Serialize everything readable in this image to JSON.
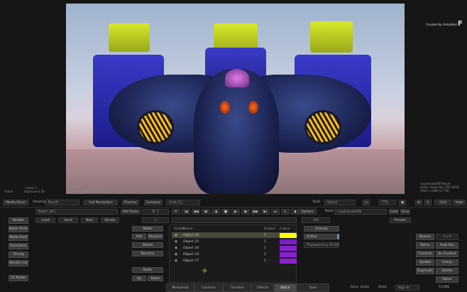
{
  "viewer": {
    "brand_text": "Created by Autodesk",
    "brand_logo": "F",
    "info_right": [
      "cryptomattefB Result",
      "Active linear Rec 709 sRGB",
      "1920 x 1080 (1.778)"
    ],
    "info_left_status": "Active",
    "info_left_a": "Linear 1",
    "info_left_b": "Exposure 0.00",
    "info_left_c": "Contrast 1.00",
    "info_left_d": "Gamma 2.20",
    "info_left_e": "Look off"
  },
  "toolbar": {
    "media_panel": "Media Panel",
    "viewing_label": "Viewing",
    "viewing_value": "Result",
    "full_resolution": "Full Resolution",
    "preview": "Preview",
    "compare": "Compare",
    "grab": "Grab [1]",
    "tools_label": "Tools",
    "tools_value": "Select",
    "ratio_value": "TTR",
    "grid": "Grid",
    "view": "View"
  },
  "left_panel": {
    "render": "Render",
    "batch_prefs": "Batch Prefs",
    "node_prefs": "Node Prefs",
    "animation": "Animation",
    "timing": "Timing",
    "render_list": "Render List",
    "fx_nodes": "FX Nodes",
    "batch_name": "Batch_001",
    "add_token": "Add Token",
    "load": "Load",
    "save": "Save",
    "new": "New",
    "iterate": "Iterate",
    "frame_a": "B: 1",
    "frame_b": "1"
  },
  "matte_panel": {
    "matte": "Matte",
    "add": "Add",
    "replace": "Replace",
    "delete": "Delete",
    "rename": "Rename",
    "order": "Order",
    "up": "Up",
    "down": "Down"
  },
  "object_list": {
    "headers": [
      "Visible",
      "Name",
      "Output",
      "Colour"
    ],
    "rows": [
      {
        "name": "Object 28",
        "output": "1",
        "color": "#ffff00"
      },
      {
        "name": "Object 25",
        "output": "1",
        "color": "#7a1ec8"
      },
      {
        "name": "Object 26",
        "output": "1",
        "color": "#8a22d0"
      },
      {
        "name": "Object 19",
        "output": "1",
        "color": "#8a22d0"
      },
      {
        "name": "Object 17",
        "output": "1",
        "color": "#8a22d0"
      }
    ]
  },
  "options_panel": {
    "options": "Options",
    "node_label": "Node",
    "node_value": "cryptomatteFB",
    "load": "Load",
    "save": "Save",
    "presets": "Presets",
    "frame_value": "100",
    "overlay": "Overlay",
    "active": "Active",
    "transparency": "Transparency 10.00"
  },
  "right_panel": {
    "bypass": "Bypass",
    "front": "Front",
    "batch": "Batch",
    "auto_key": "Auto Key",
    "context": "Context",
    "au_context": "Au Context",
    "update": "Update",
    "group": "Group",
    "duplicate": "Duplicate",
    "delete": "Delete",
    "reset": "Reset"
  },
  "tabs": [
    "MediaHub",
    "Conform",
    "Timeline",
    "Effects",
    "Batch",
    "Tools"
  ],
  "status": {
    "save": "Save",
    "undo": "Undo",
    "redo": "Redo",
    "sign_in": "Sign In",
    "app_name": "FLAME"
  }
}
